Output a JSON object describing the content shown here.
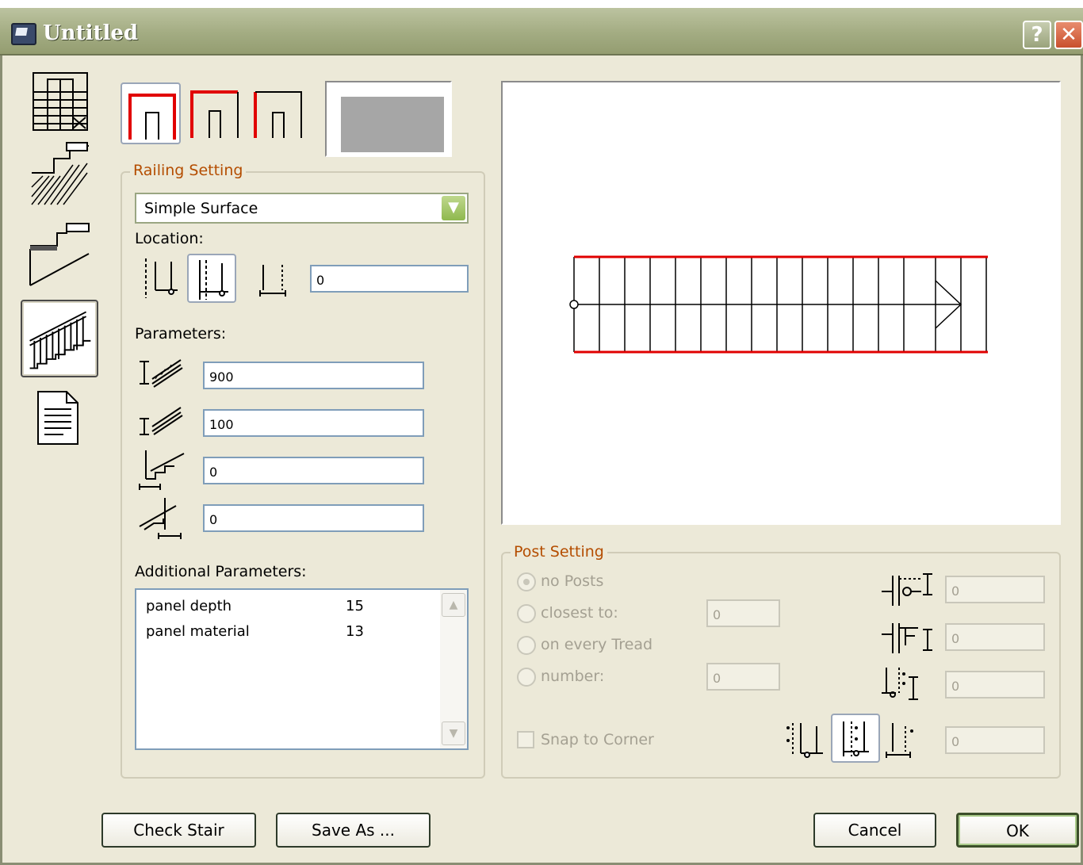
{
  "window": {
    "title": "Untitled",
    "help_label": "?",
    "close_label": "✕"
  },
  "railing_setting": {
    "legend": "Railing Setting",
    "surface_select": "Simple Surface",
    "location_label": "Location:",
    "location_value": "0",
    "parameters_label": "Parameters:",
    "param_values": [
      "900",
      "100",
      "0",
      "0"
    ],
    "additional_label": "Additional Parameters:",
    "additional": [
      {
        "name": "panel depth",
        "value": "15"
      },
      {
        "name": "panel material",
        "value": "13"
      }
    ]
  },
  "post_setting": {
    "legend": "Post Setting",
    "options": [
      "no Posts",
      "closest to:",
      "on every Tread",
      "number:"
    ],
    "closest_value": "0",
    "number_value": "0",
    "snap_label": "Snap to Corner",
    "right_values": [
      "0",
      "0",
      "0",
      "0"
    ]
  },
  "buttons": {
    "check_stair": "Check Stair",
    "save_as": "Save As ...",
    "cancel": "Cancel",
    "ok": "OK"
  },
  "colors": {
    "accent_red": "#e10000",
    "legend_orange": "#b44d00",
    "title_bar": "#a3ac82",
    "dialog_bg": "#ece9d8"
  },
  "icons": [
    "stair-plan-icon",
    "stair-section-icon",
    "stair-profile-icon",
    "railing-icon",
    "document-icon"
  ]
}
